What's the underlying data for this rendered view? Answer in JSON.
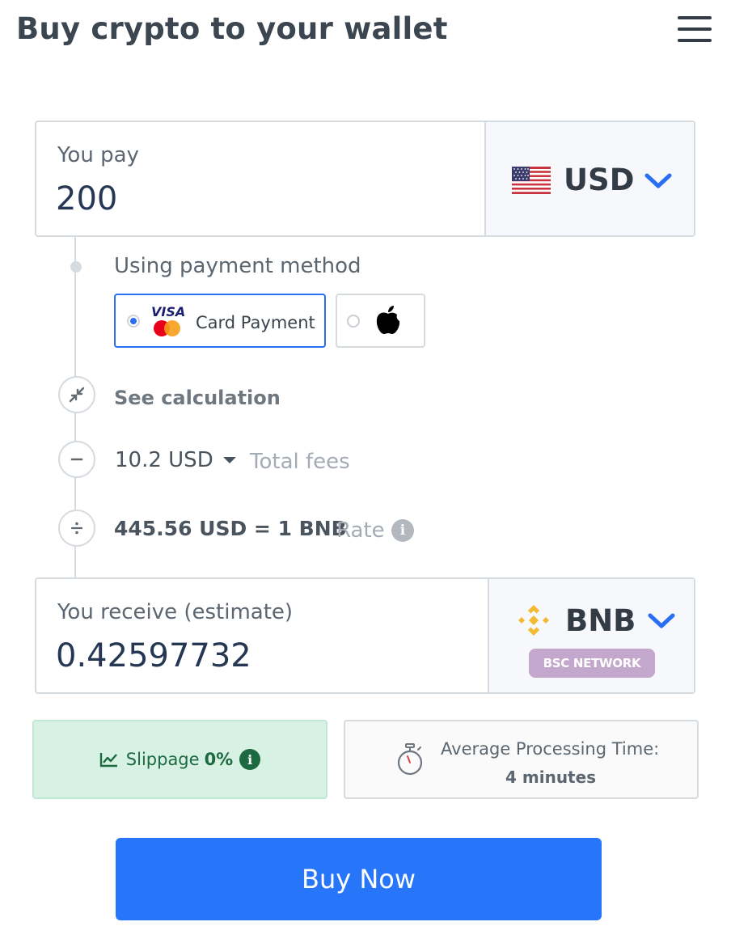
{
  "header": {
    "title": "Buy crypto to your wallet",
    "menu_icon": "hamburger-menu-icon"
  },
  "pay": {
    "label": "You pay",
    "amount": "200",
    "currency": "USD",
    "flag_icon": "us-flag-icon"
  },
  "payment_method": {
    "label": "Using payment method",
    "options": [
      {
        "label": "Card Payment",
        "selected": true,
        "icon": "visa-mastercard-icon"
      },
      {
        "label": "",
        "selected": false,
        "icon": "apple-icon"
      }
    ]
  },
  "calculation": {
    "toggle_label": "See calculation",
    "fee_value": "10.2 USD",
    "fee_label": "Total fees",
    "rate_value": "445.56 USD = 1 BNB",
    "rate_label": "Rate"
  },
  "receive": {
    "label": "You receive (estimate)",
    "amount": "0.42597732",
    "currency": "BNB",
    "network": "BSC NETWORK",
    "coin_icon": "bnb-icon"
  },
  "slippage": {
    "label": "Slippage",
    "value": "0%"
  },
  "processing": {
    "label": "Average Processing Time:",
    "value": "4 minutes"
  },
  "buy_button": {
    "label": "Buy Now"
  },
  "colors": {
    "primary": "#2776fa",
    "brand_bnb": "#f3ba2f",
    "success_bg": "#d7f1e5",
    "network_badge": "#c4a7cc"
  }
}
